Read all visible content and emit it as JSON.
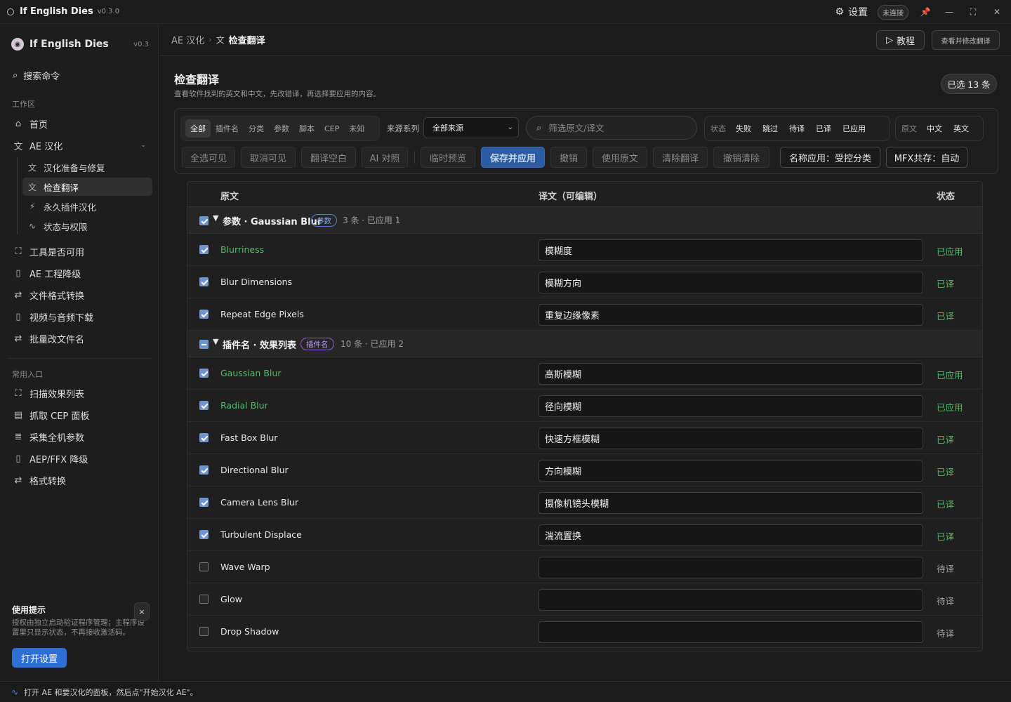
{
  "window": {
    "title": "If English Dies",
    "version": "v0.3.0",
    "settings": "设置",
    "connection": "未连接",
    "pin": "📌",
    "minimize": "—",
    "maximize": "⛶",
    "close": "✕"
  },
  "sidebar": {
    "brand": "If English Dies",
    "brand_version": "v0.3",
    "search": "搜索命令",
    "section_work": "工作区",
    "home": "首页",
    "ae_cn": "AE 汉化",
    "sub": [
      "汉化准备与修复",
      "检查翻译",
      "永久插件汉化",
      "状态与权限"
    ],
    "tools": [
      "工具是否可用",
      "AE 工程降级",
      "文件格式转换",
      "视频与音频下载",
      "批量改文件名"
    ],
    "section_common": "常用入口",
    "common": [
      "扫描效果列表",
      "抓取 CEP 面板",
      "采集全机参数",
      "AEP/FFX 降级",
      "格式转换"
    ],
    "tip_title": "使用提示",
    "tip_text": "授权由独立启动验证程序管理；主程序设置里只显示状态，不再接收激活码。",
    "tip_close": "×",
    "tip_button": "打开设置"
  },
  "breadcrumb": {
    "parent": "AE 汉化",
    "current": "检查翻译"
  },
  "header_buttons": {
    "tutorial": "教程",
    "view_edit": "查看并修改翻译"
  },
  "page": {
    "title": "检查翻译",
    "subtitle": "查看软件找到的英文和中文，先改错译，再选择要应用的内容。",
    "selected": "已选 13 条"
  },
  "filters": {
    "categories": [
      "全部",
      "插件名",
      "分类",
      "参数",
      "脚本",
      "CEP",
      "未知"
    ],
    "source_label": "来源系列",
    "source_value": "全部来源",
    "search_placeholder": "筛选原文/译文",
    "state_label": "状态",
    "states": [
      "失败",
      "跳过",
      "待译",
      "已译",
      "已应用"
    ],
    "lang_label": "原文",
    "langs": [
      "中文",
      "英文"
    ]
  },
  "actions": [
    "全选可见",
    "取消可见",
    "翻译空白",
    "AI 对照",
    "临时预览",
    "保存并应用",
    "撤销",
    "使用原文",
    "清除翻译",
    "撤销清除",
    "名称应用：受控分类",
    "MFX共存：自动"
  ],
  "table": {
    "headers": {
      "source": "原文",
      "target": "译文（可编辑）",
      "status": "状态"
    },
    "groups": [
      {
        "title": "参数 · Gaussian Blur",
        "tag": "参数",
        "count": "3 条 · 已应用 1",
        "rows": [
          {
            "src": "Blurriness",
            "dst": "模糊度",
            "status": "已应用"
          },
          {
            "src": "Blur Dimensions",
            "dst": "模糊方向",
            "status": "已译"
          },
          {
            "src": "Repeat Edge Pixels",
            "dst": "重复边缘像素",
            "status": "已译"
          }
        ]
      },
      {
        "title": "插件名 · 效果列表",
        "tag": "插件名",
        "count": "10 条 · 已应用 2",
        "rows": [
          {
            "src": "Gaussian Blur",
            "dst": "高斯模糊",
            "status": "已应用"
          },
          {
            "src": "Radial Blur",
            "dst": "径向模糊",
            "status": "已应用"
          },
          {
            "src": "Fast Box Blur",
            "dst": "快速方框模糊",
            "status": "已译"
          },
          {
            "src": "Directional Blur",
            "dst": "方向模糊",
            "status": "已译"
          },
          {
            "src": "Camera Lens Blur",
            "dst": "摄像机镜头模糊",
            "status": "已译"
          },
          {
            "src": "Turbulent Displace",
            "dst": "湍流置换",
            "status": "已译"
          },
          {
            "src": "Wave Warp",
            "dst": "",
            "status": "待译"
          },
          {
            "src": "Glow",
            "dst": "",
            "status": "待译"
          },
          {
            "src": "Drop Shadow",
            "dst": "",
            "status": "待译"
          }
        ]
      }
    ]
  },
  "statusbar": "打开 AE 和要汉化的面板，然后点\"开始汉化 AE\"。"
}
